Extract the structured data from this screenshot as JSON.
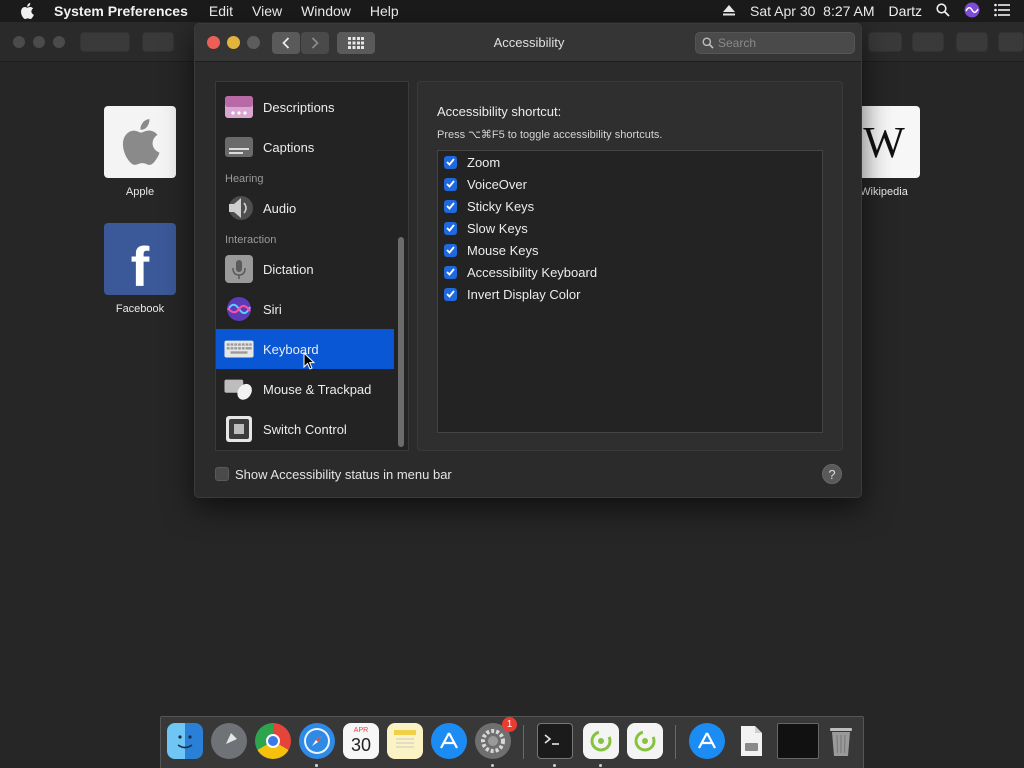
{
  "menubar": {
    "app_name": "System Preferences",
    "menus": [
      "Edit",
      "View",
      "Window",
      "Help"
    ],
    "datetime": "Sat Apr 30  8:27 AM",
    "user": "Dartz"
  },
  "safari": {
    "favorites": [
      {
        "label": "Apple"
      },
      {
        "label": "Facebook"
      },
      {
        "label": "Wikipedia"
      }
    ]
  },
  "window": {
    "title": "Accessibility",
    "search_placeholder": "Search"
  },
  "sidebar": {
    "items": [
      {
        "label": "Descriptions",
        "icon": "descriptions-icon"
      },
      {
        "label": "Captions",
        "icon": "captions-icon"
      },
      {
        "header": "Hearing"
      },
      {
        "label": "Audio",
        "icon": "speaker-icon"
      },
      {
        "header": "Interaction"
      },
      {
        "label": "Dictation",
        "icon": "microphone-icon"
      },
      {
        "label": "Siri",
        "icon": "siri-icon"
      },
      {
        "label": "Keyboard",
        "icon": "keyboard-icon",
        "selected": true
      },
      {
        "label": "Mouse & Trackpad",
        "icon": "mouse-icon"
      },
      {
        "label": "Switch Control",
        "icon": "switch-control-icon"
      }
    ]
  },
  "panel": {
    "title": "Accessibility shortcut:",
    "subtitle": "Press ⌥⌘F5 to toggle accessibility shortcuts.",
    "options": [
      {
        "label": "Zoom",
        "checked": true
      },
      {
        "label": "VoiceOver",
        "checked": true
      },
      {
        "label": "Sticky Keys",
        "checked": true
      },
      {
        "label": "Slow Keys",
        "checked": true
      },
      {
        "label": "Mouse Keys",
        "checked": true
      },
      {
        "label": "Accessibility Keyboard",
        "checked": true
      },
      {
        "label": "Invert Display Color",
        "checked": true
      }
    ]
  },
  "footer": {
    "status_label": "Show Accessibility status in menu bar",
    "status_checked": false,
    "help_label": "?"
  },
  "dock": {
    "apps": [
      "finder-icon",
      "launchpad-icon",
      "chrome-icon",
      "safari-icon",
      "calendar-icon",
      "notes-icon",
      "app-store-icon",
      "system-preferences-icon",
      "terminal-icon",
      "android-file-icon",
      "android-file-icon-2",
      "app-store-downloads-icon",
      "document-icon",
      "screen-icon",
      "trash-icon"
    ],
    "calendar_month": "APR",
    "calendar_day": "30",
    "badge": "1"
  },
  "colors": {
    "accent": "#0a57d6",
    "checkbox": "#1e68e0",
    "close": "#ec5f57",
    "minimize": "#e1b43e"
  }
}
